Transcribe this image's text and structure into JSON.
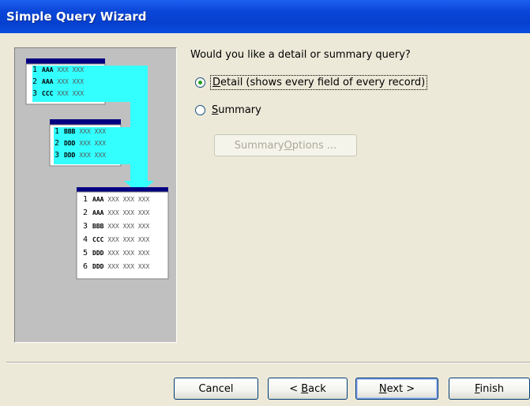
{
  "window": {
    "title": "Simple Query Wizard"
  },
  "prompt": {
    "question": "Would you like a detail or summary query?"
  },
  "options": {
    "detail": {
      "label": "Detail (shows every field of every record)",
      "selected": true
    },
    "summary": {
      "label": "Summary",
      "selected": false
    }
  },
  "summary_options_button": {
    "label": "Summary Options ...",
    "enabled": false
  },
  "footer": {
    "cancel": "Cancel",
    "back": "< Back",
    "next": "Next >",
    "finish": "Finish"
  },
  "illustration": {
    "table1": [
      {
        "n": "1",
        "k": "AAA",
        "x": "XXX XXX"
      },
      {
        "n": "2",
        "k": "AAA",
        "x": "XXX XXX"
      },
      {
        "n": "3",
        "k": "CCC",
        "x": "XXX XXX"
      }
    ],
    "table2": [
      {
        "n": "1",
        "k": "BBB",
        "x": "XXX XXX"
      },
      {
        "n": "2",
        "k": "DDD",
        "x": "XXX XXX"
      },
      {
        "n": "3",
        "k": "DDD",
        "x": "XXX XXX"
      }
    ],
    "result": [
      {
        "n": "1",
        "k": "AAA",
        "x": "XXX XXX XXX"
      },
      {
        "n": "2",
        "k": "AAA",
        "x": "XXX XXX XXX"
      },
      {
        "n": "3",
        "k": "BBB",
        "x": "XXX XXX XXX"
      },
      {
        "n": "4",
        "k": "CCC",
        "x": "XXX XXX XXX"
      },
      {
        "n": "5",
        "k": "DDD",
        "x": "XXX XXX XXX"
      },
      {
        "n": "6",
        "k": "DDD",
        "x": "XXX XXX XXX"
      }
    ],
    "colors": {
      "highlight": "#33ffff",
      "header": "#000080",
      "panel": "#c0c0c0"
    }
  }
}
